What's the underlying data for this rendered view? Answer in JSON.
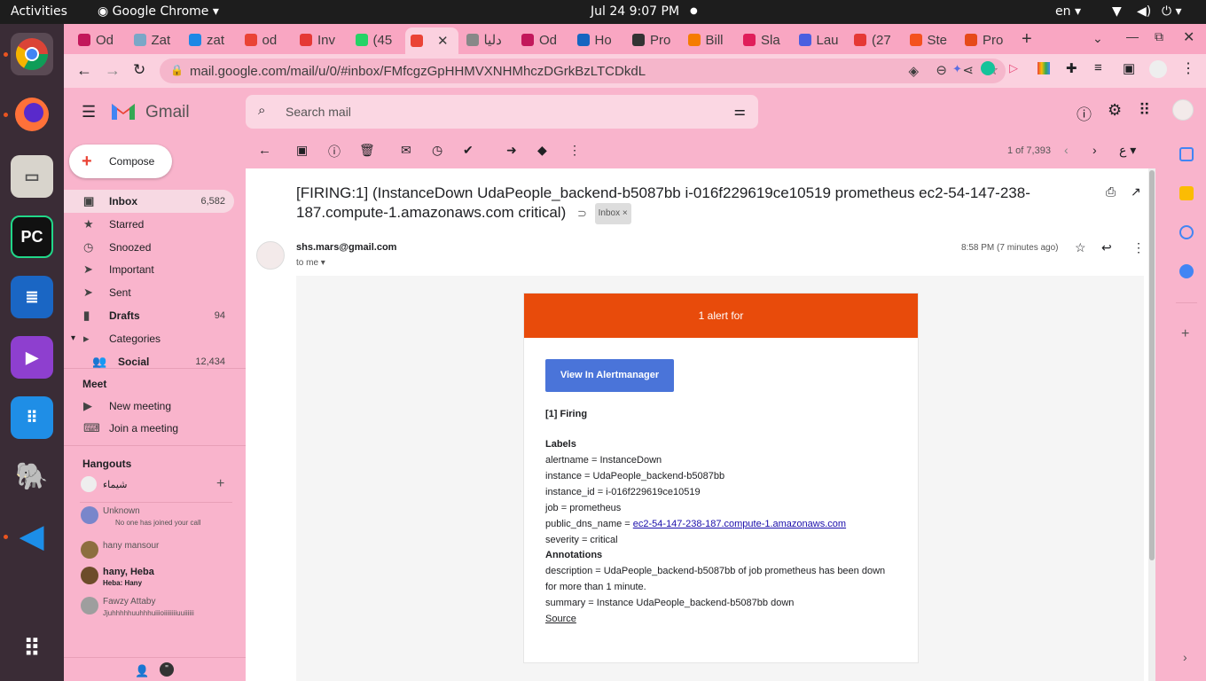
{
  "system": {
    "activities": "Activities",
    "app": "Google Chrome",
    "clock": "Jul 24  9:07 PM",
    "lang": "en"
  },
  "dock": [
    "chrome-icon",
    "firefox-icon",
    "files-icon",
    "pycharm-icon",
    "libreoffice-writer-icon",
    "media-player-icon",
    "software-icon",
    "postgres-icon",
    "vscode-icon",
    "show-apps-icon"
  ],
  "tabs": [
    "Od",
    "Zat",
    "zat",
    "od",
    "Inv",
    "(45",
    "",
    "دليا",
    "Od",
    "Ho",
    "Pro",
    "Bill",
    "Sla",
    "Lau",
    "(27",
    "Ste",
    "Pro"
  ],
  "address": {
    "url": "mail.google.com/mail/u/0/#inbox/FMfcgzGpHHMVXNHMhczDGrkBzLTCDkdL"
  },
  "gmail": {
    "brand": "Gmail",
    "search_placeholder": "Search mail",
    "compose": "Compose",
    "nav": [
      {
        "label": "Inbox",
        "count": "6,582"
      },
      {
        "label": "Starred",
        "count": ""
      },
      {
        "label": "Snoozed",
        "count": ""
      },
      {
        "label": "Important",
        "count": ""
      },
      {
        "label": "Sent",
        "count": ""
      },
      {
        "label": "Drafts",
        "count": "94"
      },
      {
        "label": "Categories",
        "count": ""
      },
      {
        "label": "Social",
        "count": "12,434"
      }
    ],
    "meet": {
      "title": "Meet",
      "new": "New meeting",
      "join": "Join a meeting"
    },
    "hangouts": {
      "title": "Hangouts",
      "me": "شيماء",
      "contacts": [
        {
          "name": "Unknown",
          "sub": "No one has joined your call"
        },
        {
          "name": "hany mansour",
          "sub": ""
        },
        {
          "name": "hany, Heba",
          "sub": "Heba: Hany"
        },
        {
          "name": "Fawzy Attaby",
          "sub": "Jjuhhhhhuuhhhuiiioiiiiiiiiuuiiiiii"
        }
      ]
    },
    "pager": "1 of 7,393",
    "subject": "[FIRING:1] (InstanceDown UdaPeople_backend-b5087bb i-016f229619ce10519 prometheus ec2-54-147-238-187.compute-1.amazonaws.com critical)",
    "label": "Inbox",
    "sender": "shs.mars@gmail.com",
    "to": "to me",
    "time": "8:58 PM (7 minutes ago)",
    "alert": {
      "banner": "1 alert for",
      "button": "View In Alertmanager",
      "firing": "[1] Firing",
      "labels_title": "Labels",
      "labels": [
        "alertname = InstanceDown",
        "instance = UdaPeople_backend-b5087bb",
        "instance_id = i-016f229619ce10519",
        "job = prometheus"
      ],
      "dns_key": "public_dns_name = ",
      "dns_val": "ec2-54-147-238-187.compute-1.amazonaws.com",
      "severity": "severity = critical",
      "annotations_title": "Annotations",
      "desc1": "description = UdaPeople_backend-b5087bb of job prometheus has been down",
      "desc2": "for more than 1 minute.",
      "summary": "summary = Instance UdaPeople_backend-b5087bb down",
      "source": "Source"
    }
  }
}
